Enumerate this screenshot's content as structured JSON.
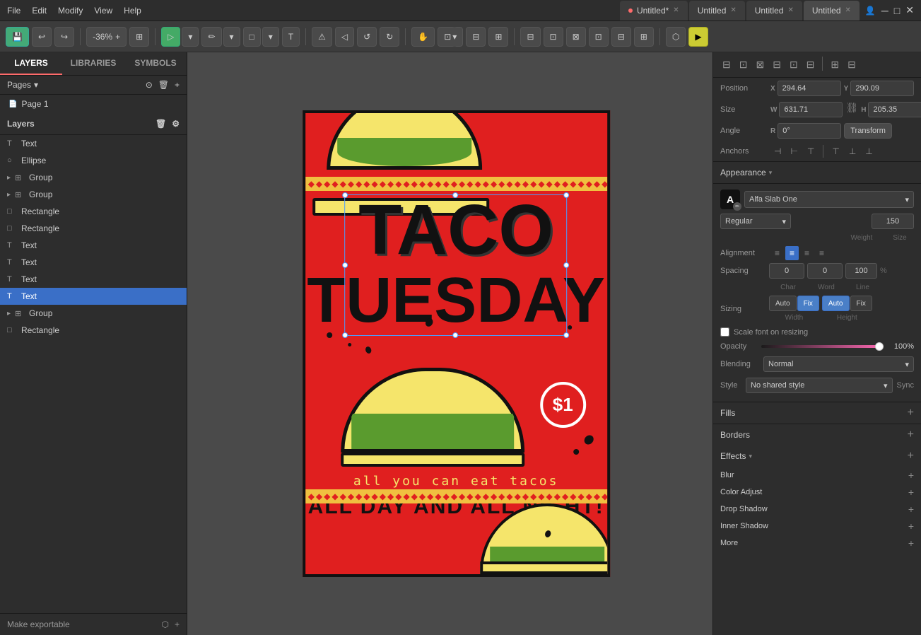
{
  "menu": {
    "items": [
      "File",
      "Edit",
      "Modify",
      "View",
      "Help"
    ]
  },
  "tabs": [
    {
      "id": "tab1",
      "label": "Untitled*",
      "active": false,
      "dot": true
    },
    {
      "id": "tab2",
      "label": "Untitled",
      "active": false
    },
    {
      "id": "tab3",
      "label": "Untitled",
      "active": false
    },
    {
      "id": "tab4",
      "label": "Untitled",
      "active": true
    }
  ],
  "toolbar": {
    "zoom": "-36%",
    "zoom_plus": "+",
    "tools": [
      "select",
      "draw",
      "rectangle",
      "text",
      "pencil",
      "hand",
      "zoom"
    ],
    "transform_tools": [
      "flip_h",
      "flip_v",
      "rotate_ccw",
      "rotate_cw"
    ],
    "snap_tools": [
      "arrange",
      "distribute",
      "align1",
      "align2",
      "align3",
      "align4",
      "align5",
      "align6"
    ]
  },
  "left_panel": {
    "tabs": [
      "LAYERS",
      "LIBRARIES",
      "SYMBOLS"
    ],
    "active_tab": "LAYERS",
    "pages_label": "Pages",
    "pages": [
      {
        "label": "Page 1",
        "icon": "📄"
      }
    ],
    "layers_label": "Layers",
    "layers": [
      {
        "type": "text",
        "label": "Text",
        "icon": "T",
        "expanded": false,
        "indent": 0
      },
      {
        "type": "ellipse",
        "label": "Ellipse",
        "icon": "○",
        "indent": 0
      },
      {
        "type": "group",
        "label": "Group",
        "icon": "⊞",
        "indent": 0
      },
      {
        "type": "group",
        "label": "Group",
        "icon": "⊞",
        "indent": 0,
        "has_expand": true
      },
      {
        "type": "rect",
        "label": "Rectangle",
        "icon": "□",
        "indent": 0
      },
      {
        "type": "rect",
        "label": "Rectangle",
        "icon": "□",
        "indent": 0
      },
      {
        "type": "text",
        "label": "Text",
        "icon": "T",
        "indent": 0
      },
      {
        "type": "text",
        "label": "Text",
        "icon": "T",
        "indent": 0
      },
      {
        "type": "text",
        "label": "Text",
        "icon": "T",
        "indent": 0
      },
      {
        "type": "text",
        "label": "Text",
        "icon": "T",
        "indent": 0,
        "selected": true
      },
      {
        "type": "group",
        "label": "Group",
        "icon": "⊞",
        "indent": 0,
        "has_expand": true
      },
      {
        "type": "rect",
        "label": "Rectangle",
        "icon": "□",
        "indent": 0
      }
    ],
    "export_label": "Make exportable"
  },
  "right_panel": {
    "position": {
      "label": "Position",
      "x_label": "X",
      "x_value": "294.64",
      "y_label": "Y",
      "y_value": "290.09"
    },
    "size": {
      "label": "Size",
      "w_label": "W",
      "w_value": "631.71",
      "h_label": "H",
      "h_value": "205.35"
    },
    "angle": {
      "label": "Angle",
      "r_label": "R",
      "r_value": "0°",
      "transform_btn": "Transform"
    },
    "anchors": {
      "label": "Anchors"
    },
    "appearance": {
      "label": "Appearance",
      "font_name": "Alfa Slab One",
      "color_label": "Color",
      "color_value": "Regular",
      "weight_value": "150",
      "weight_label": "Weight",
      "size_label": "Size",
      "alignment_label": "Alignment",
      "spacing_label": "Spacing",
      "char_value": "0",
      "word_value": "0",
      "line_value": "100",
      "percent": "%",
      "char_label": "Char",
      "word_label": "Word",
      "line_label": "Line",
      "sizing_label": "Sizing",
      "sizing_options": [
        {
          "label": "Auto",
          "type": "width",
          "active": false
        },
        {
          "label": "Fix",
          "type": "width",
          "active": true
        },
        {
          "label": "Auto",
          "type": "height",
          "active": true
        },
        {
          "label": "Fix",
          "type": "height",
          "active": false
        }
      ],
      "width_label": "Width",
      "height_label": "Height",
      "scale_font_label": "Scale font on resizing",
      "opacity_label": "Opacity",
      "opacity_value": "100%",
      "blending_label": "Blending",
      "blending_value": "Normal",
      "style_label": "Style",
      "style_value": "No shared style",
      "sync_label": "Sync"
    },
    "fills": {
      "label": "Fills"
    },
    "borders": {
      "label": "Borders"
    },
    "effects": {
      "label": "Effects",
      "items": [
        {
          "label": "Blur"
        },
        {
          "label": "Color Adjust"
        },
        {
          "label": "Drop Shadow"
        },
        {
          "label": "Inner Shadow"
        },
        {
          "label": "More"
        }
      ]
    }
  },
  "poster": {
    "title_line1": "TACO",
    "title_line2": "TUESDAY",
    "subtitle": "all you can eat tacos",
    "bottom_text": "ALL DAY AND ALL  NIGHT!",
    "badge": "$1",
    "bg_color": "#e01f1f"
  }
}
